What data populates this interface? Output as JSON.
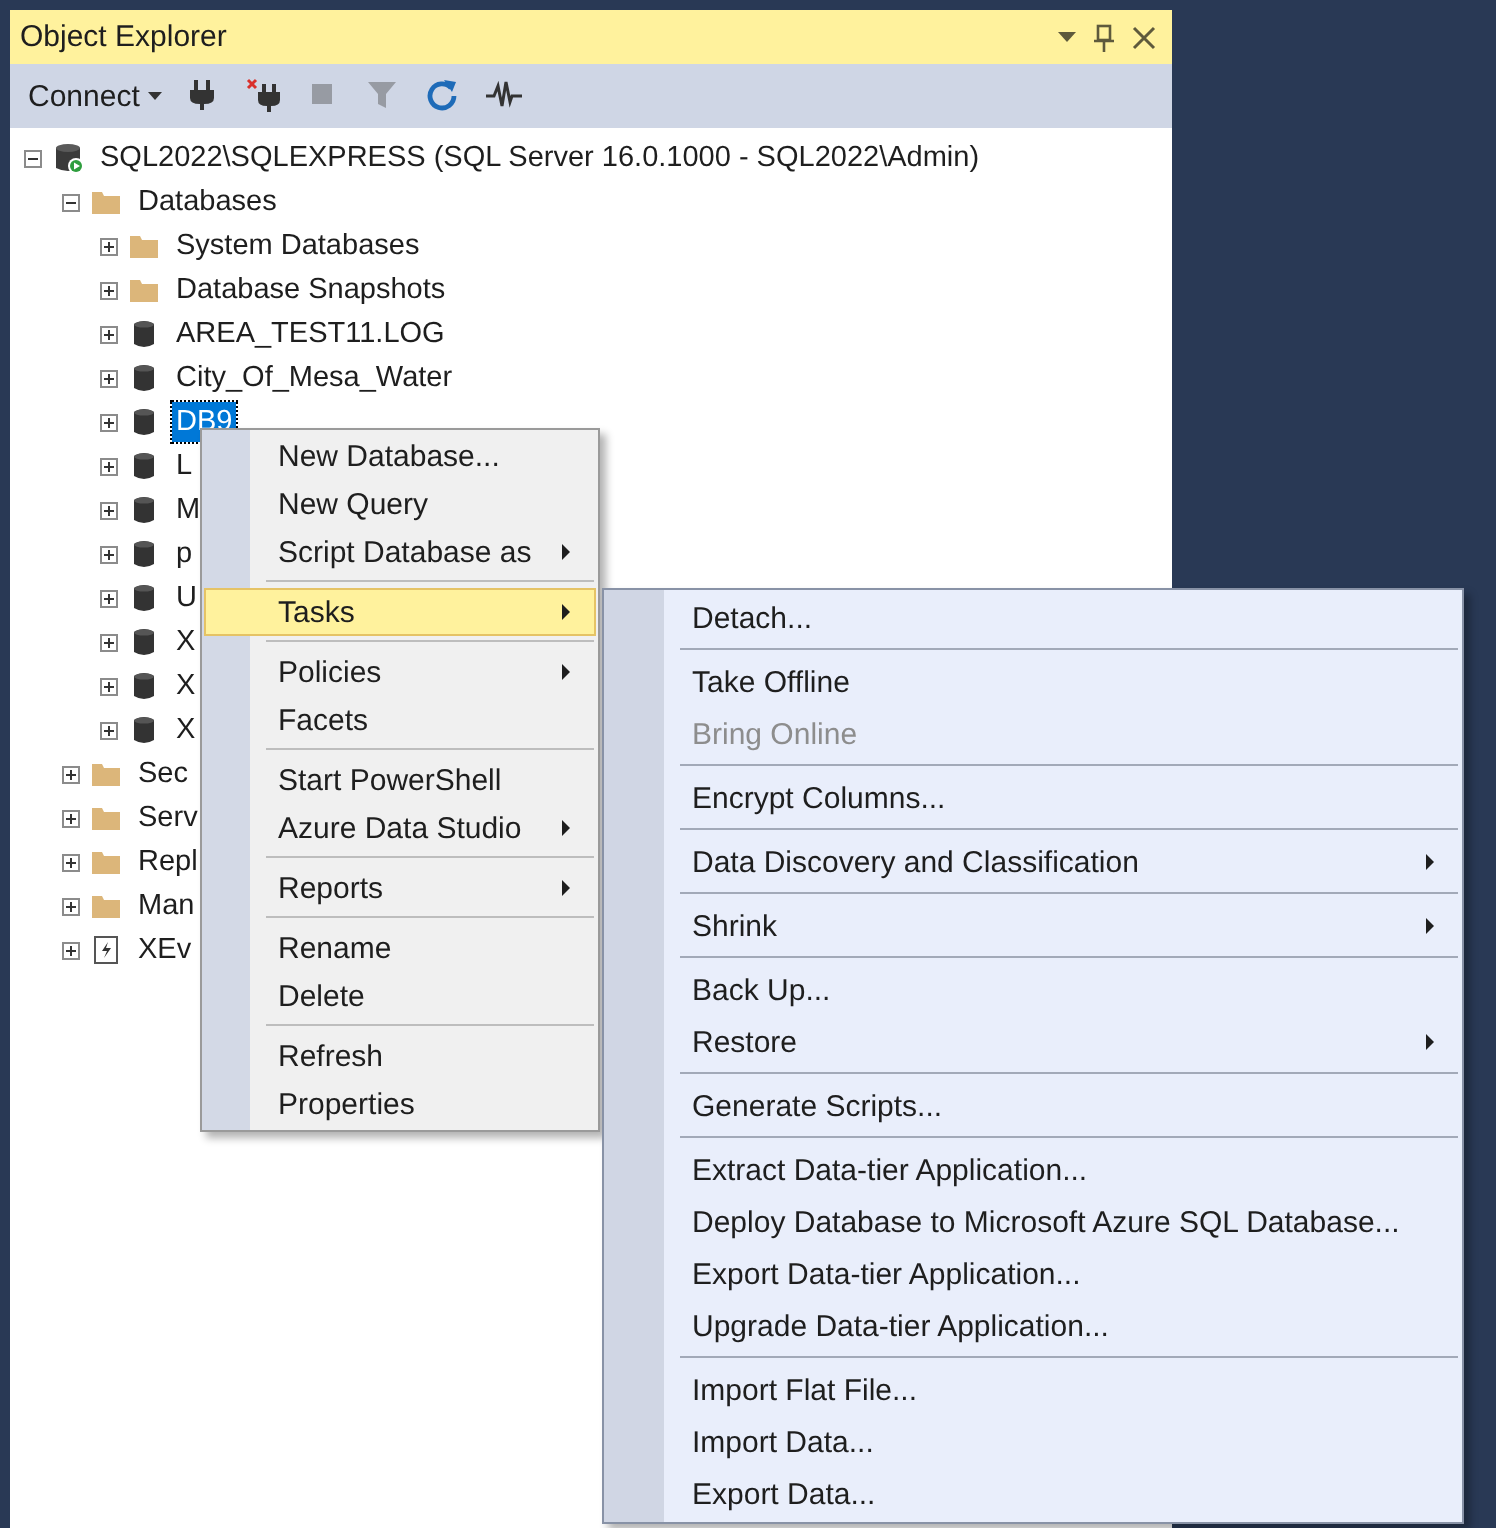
{
  "panel": {
    "title": "Object Explorer"
  },
  "toolbar": [
    {
      "kind": "connect",
      "label": "Connect",
      "disabled": false
    },
    {
      "kind": "plug",
      "disabled": false
    },
    {
      "kind": "unplug",
      "disabled": false
    },
    {
      "kind": "stop",
      "disabled": true
    },
    {
      "kind": "filter",
      "disabled": true
    },
    {
      "kind": "refresh",
      "disabled": false
    },
    {
      "kind": "activity",
      "disabled": false
    }
  ],
  "tree": [
    {
      "label": "SQL2022\\SQLEXPRESS (SQL Server 16.0.1000 - SQL2022\\Admin)",
      "kind": "server",
      "expanded": true,
      "selected": false,
      "children": [
        {
          "label": "Databases",
          "kind": "folder",
          "expanded": true,
          "selected": false,
          "children": [
            {
              "label": "System Databases",
              "kind": "folder",
              "expanded": false,
              "selected": false
            },
            {
              "label": "Database Snapshots",
              "kind": "folder",
              "expanded": false,
              "selected": false
            },
            {
              "label": "AREA_TEST11.LOG",
              "kind": "database",
              "expanded": false,
              "selected": false
            },
            {
              "label": "City_Of_Mesa_Water",
              "kind": "database",
              "expanded": false,
              "selected": false
            },
            {
              "label": "DB9",
              "kind": "database",
              "expanded": false,
              "selected": true
            },
            {
              "label": "L",
              "kind": "database",
              "expanded": false,
              "selected": false
            },
            {
              "label": "M",
              "kind": "database",
              "expanded": false,
              "selected": false
            },
            {
              "label": "p",
              "kind": "database",
              "expanded": false,
              "selected": false
            },
            {
              "label": "U",
              "kind": "database",
              "expanded": false,
              "selected": false
            },
            {
              "label": "X",
              "kind": "database",
              "expanded": false,
              "selected": false
            },
            {
              "label": "X",
              "kind": "database",
              "expanded": false,
              "selected": false
            },
            {
              "label": "X",
              "kind": "database",
              "expanded": false,
              "selected": false
            }
          ]
        },
        {
          "label": "Sec",
          "kind": "folder",
          "expanded": false,
          "selected": false
        },
        {
          "label": "Serv",
          "kind": "folder",
          "expanded": false,
          "selected": false
        },
        {
          "label": "Repl",
          "kind": "folder",
          "expanded": false,
          "selected": false
        },
        {
          "label": "Man",
          "kind": "folder",
          "expanded": false,
          "selected": false
        },
        {
          "label": "XEv",
          "kind": "xevent",
          "expanded": false,
          "selected": false
        }
      ]
    }
  ],
  "context_menu": [
    {
      "kind": "item",
      "label": "New Database...",
      "submenu": false,
      "selected": false,
      "disabled": false
    },
    {
      "kind": "item",
      "label": "New Query",
      "submenu": false,
      "selected": false,
      "disabled": false
    },
    {
      "kind": "item",
      "label": "Script Database as",
      "submenu": true,
      "selected": false,
      "disabled": false
    },
    {
      "kind": "separator"
    },
    {
      "kind": "item",
      "label": "Tasks",
      "submenu": true,
      "selected": true,
      "disabled": false
    },
    {
      "kind": "separator"
    },
    {
      "kind": "item",
      "label": "Policies",
      "submenu": true,
      "selected": false,
      "disabled": false
    },
    {
      "kind": "item",
      "label": "Facets",
      "submenu": false,
      "selected": false,
      "disabled": false
    },
    {
      "kind": "separator"
    },
    {
      "kind": "item",
      "label": "Start PowerShell",
      "submenu": false,
      "selected": false,
      "disabled": false
    },
    {
      "kind": "item",
      "label": "Azure Data Studio",
      "submenu": true,
      "selected": false,
      "disabled": false
    },
    {
      "kind": "separator"
    },
    {
      "kind": "item",
      "label": "Reports",
      "submenu": true,
      "selected": false,
      "disabled": false
    },
    {
      "kind": "separator"
    },
    {
      "kind": "item",
      "label": "Rename",
      "submenu": false,
      "selected": false,
      "disabled": false
    },
    {
      "kind": "item",
      "label": "Delete",
      "submenu": false,
      "selected": false,
      "disabled": false
    },
    {
      "kind": "separator"
    },
    {
      "kind": "item",
      "label": "Refresh",
      "submenu": false,
      "selected": false,
      "disabled": false
    },
    {
      "kind": "item",
      "label": "Properties",
      "submenu": false,
      "selected": false,
      "disabled": false
    }
  ],
  "tasks_submenu": [
    {
      "kind": "item",
      "label": "Detach...",
      "submenu": false,
      "selected": false,
      "disabled": false
    },
    {
      "kind": "separator"
    },
    {
      "kind": "item",
      "label": "Take Offline",
      "submenu": false,
      "selected": false,
      "disabled": false
    },
    {
      "kind": "item",
      "label": "Bring Online",
      "submenu": false,
      "selected": false,
      "disabled": true
    },
    {
      "kind": "separator"
    },
    {
      "kind": "item",
      "label": "Encrypt Columns...",
      "submenu": false,
      "selected": false,
      "disabled": false
    },
    {
      "kind": "separator"
    },
    {
      "kind": "item",
      "label": "Data Discovery and Classification",
      "submenu": true,
      "selected": false,
      "disabled": false
    },
    {
      "kind": "separator"
    },
    {
      "kind": "item",
      "label": "Shrink",
      "submenu": true,
      "selected": false,
      "disabled": false
    },
    {
      "kind": "separator"
    },
    {
      "kind": "item",
      "label": "Back Up...",
      "submenu": false,
      "selected": false,
      "disabled": false
    },
    {
      "kind": "item",
      "label": "Restore",
      "submenu": true,
      "selected": false,
      "disabled": false
    },
    {
      "kind": "separator"
    },
    {
      "kind": "item",
      "label": "Generate Scripts...",
      "submenu": false,
      "selected": false,
      "disabled": false
    },
    {
      "kind": "separator"
    },
    {
      "kind": "item",
      "label": "Extract Data-tier Application...",
      "submenu": false,
      "selected": false,
      "disabled": false
    },
    {
      "kind": "item",
      "label": "Deploy Database to Microsoft Azure SQL Database...",
      "submenu": false,
      "selected": false,
      "disabled": false
    },
    {
      "kind": "item",
      "label": "Export Data-tier Application...",
      "submenu": false,
      "selected": false,
      "disabled": false
    },
    {
      "kind": "item",
      "label": "Upgrade Data-tier Application...",
      "submenu": false,
      "selected": false,
      "disabled": false
    },
    {
      "kind": "separator"
    },
    {
      "kind": "item",
      "label": "Import Flat File...",
      "submenu": false,
      "selected": false,
      "disabled": false
    },
    {
      "kind": "item",
      "label": "Import Data...",
      "submenu": false,
      "selected": false,
      "disabled": false
    },
    {
      "kind": "item",
      "label": "Export Data...",
      "submenu": false,
      "selected": false,
      "disabled": false
    }
  ]
}
